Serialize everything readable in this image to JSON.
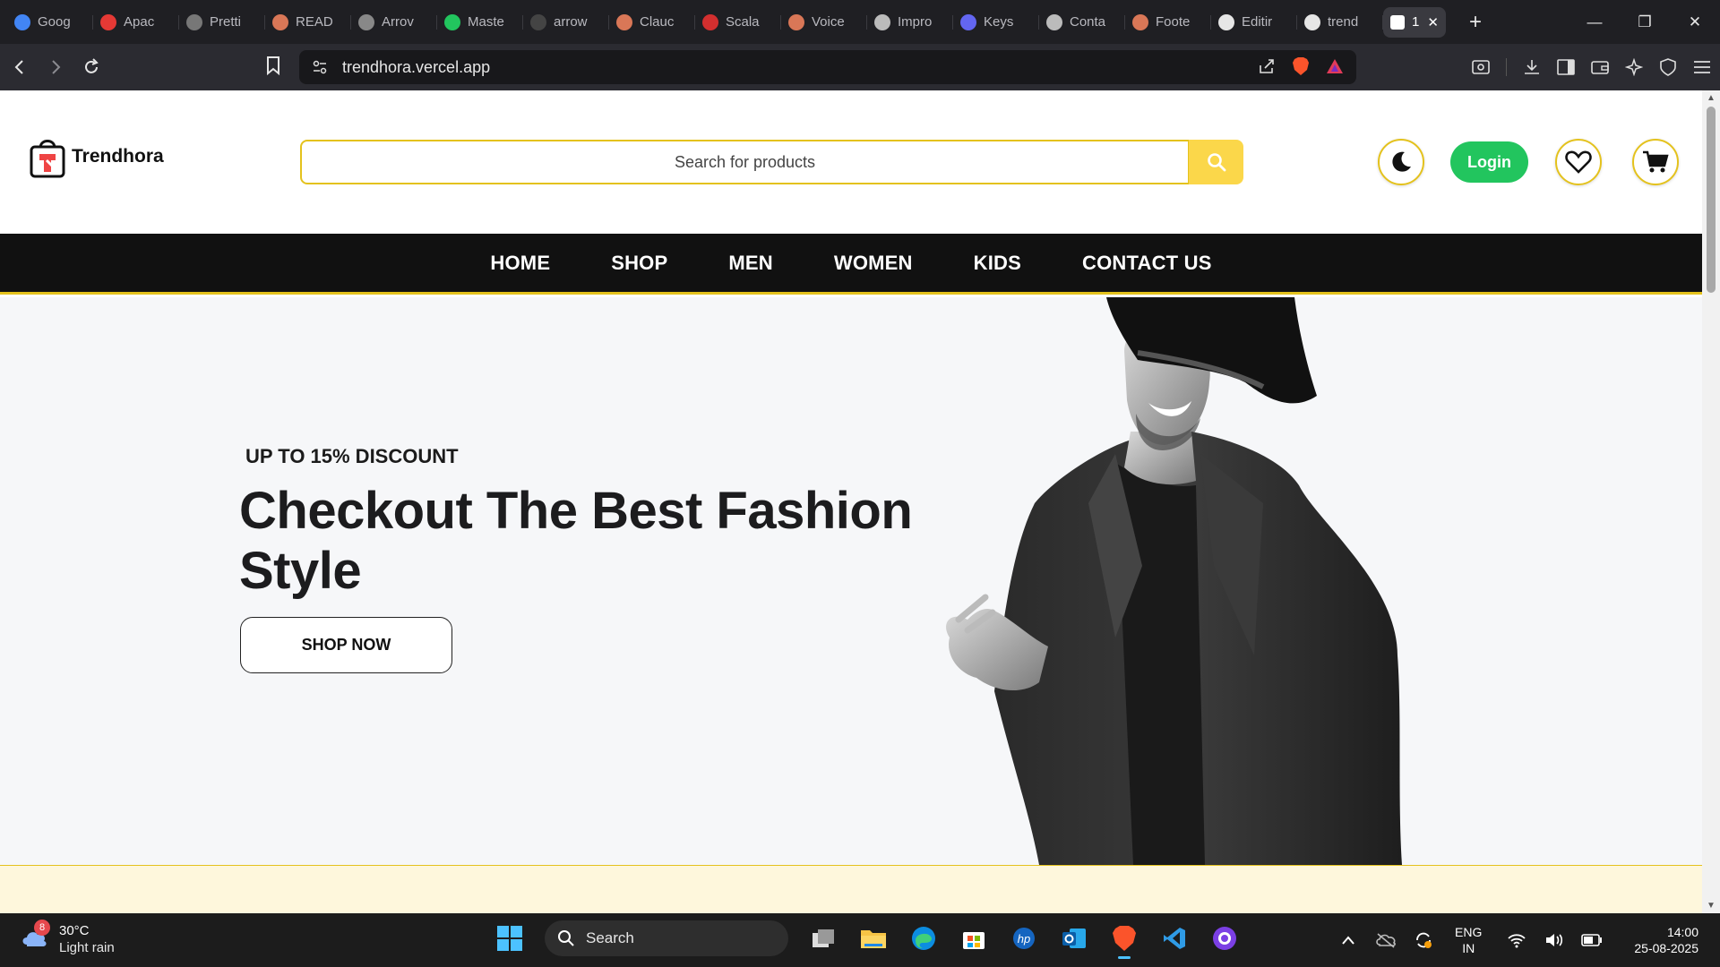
{
  "browser": {
    "tabs": [
      {
        "label": "Goog",
        "color": "#4285f4"
      },
      {
        "label": "Apac",
        "color": "#e53935"
      },
      {
        "label": "Pretti",
        "color": "#777"
      },
      {
        "label": "READ",
        "color": "#d97757"
      },
      {
        "label": "Arrov",
        "color": "#888"
      },
      {
        "label": "Maste",
        "color": "#22c55e"
      },
      {
        "label": "arrow",
        "color": "#444"
      },
      {
        "label": "Clauc",
        "color": "#d97757"
      },
      {
        "label": "Scala",
        "color": "#d32f2f"
      },
      {
        "label": "Voice",
        "color": "#d97757"
      },
      {
        "label": "Impro",
        "color": "#bbb"
      },
      {
        "label": "Keys",
        "color": "#6366f1"
      },
      {
        "label": "Conta",
        "color": "#bbb"
      },
      {
        "label": "Foote",
        "color": "#d97757"
      },
      {
        "label": "Editir",
        "color": "#e6e6e6"
      },
      {
        "label": "trend",
        "color": "#e6e6e6"
      }
    ],
    "active_tab": {
      "label": "1",
      "close": "✕"
    },
    "new_tab": "+",
    "url": "trendhora.vercel.app",
    "window": {
      "minimize": "—",
      "restore": "❐",
      "close": "✕"
    }
  },
  "site": {
    "brand": "Trendhora",
    "search_placeholder": "Search for products",
    "login_label": "Login",
    "nav": [
      "HOME",
      "SHOP",
      "MEN",
      "WOMEN",
      "KIDS",
      "CONTACT US"
    ],
    "accent": "#e4c21d",
    "login_color": "#22c55e"
  },
  "hero": {
    "kicker": "UP TO 15% DISCOUNT",
    "title": "Checkout The Best Fashion Style",
    "cta": "SHOP NOW"
  },
  "taskbar": {
    "weather_badge": "8",
    "temperature": "30°C",
    "condition": "Light rain",
    "search_label": "Search",
    "lang_1": "ENG",
    "lang_2": "IN",
    "time": "14:00",
    "date": "25-08-2025"
  }
}
